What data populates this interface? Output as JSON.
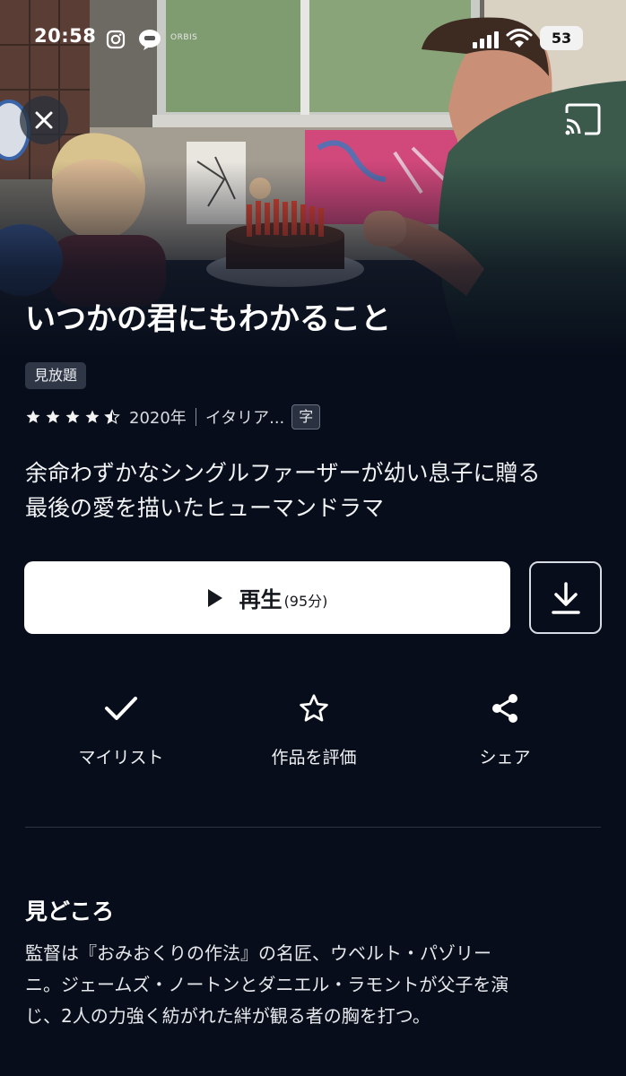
{
  "status_bar": {
    "time": "20:58",
    "brand_label": "ORBIS",
    "battery": "53",
    "icons": [
      "instagram-icon",
      "line-app-icon",
      "signal-icon",
      "wifi-icon",
      "battery-icon"
    ]
  },
  "hero": {
    "close_icon": "close-icon",
    "cast_icon": "cast-icon"
  },
  "title": {
    "text": "いつかの君にもわかること",
    "badge": "見放題"
  },
  "meta": {
    "rating_stars": 4.5,
    "year": "2020年",
    "country": "イタリア...",
    "subtitle_badge": "字"
  },
  "synopsis": {
    "line1": "余命わずかなシングルファーザーが幼い息子に贈る",
    "line2": "最後の愛を描いたヒューマンドラマ"
  },
  "play": {
    "label": "再生",
    "duration": "(95分)"
  },
  "actions": {
    "mylist": "マイリスト",
    "rate": "作品を評価",
    "share": "シェア"
  },
  "highlights": {
    "title": "見どころ",
    "line1": "監督は『おみおくりの作法』の名匠、ウベルト・パゾリー",
    "line2": "ニ。ジェームズ・ノートンとダニエル・ラモントが父子を演",
    "line3": "じ、2人の力強く紡がれた絆が観る者の胸を打つ。"
  },
  "colors": {
    "background": "#070d1a",
    "play_button": "#ffffff",
    "badge_bg": "#2f3747"
  }
}
